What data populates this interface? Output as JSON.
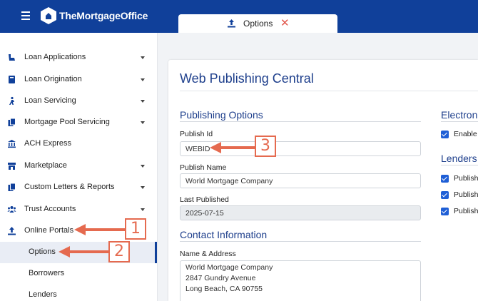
{
  "header": {
    "brand": "TheMortgageOffice",
    "tab": {
      "label": "Options",
      "close": "✕"
    }
  },
  "sidebar": {
    "items": [
      {
        "label": "Loan Applications",
        "icon": "loan-applications-icon"
      },
      {
        "label": "Loan Origination",
        "icon": "loan-origination-icon"
      },
      {
        "label": "Loan Servicing",
        "icon": "loan-servicing-icon"
      },
      {
        "label": "Mortgage Pool Servicing",
        "icon": "mortgage-pool-icon"
      },
      {
        "label": "ACH Express",
        "icon": "bank-icon"
      },
      {
        "label": "Marketplace",
        "icon": "marketplace-icon"
      },
      {
        "label": "Custom Letters & Reports",
        "icon": "letters-icon"
      },
      {
        "label": "Trust Accounts",
        "icon": "trust-accounts-icon"
      },
      {
        "label": "Online Portals",
        "icon": "upload-icon"
      }
    ],
    "subitems": [
      {
        "label": "Options"
      },
      {
        "label": "Borrowers"
      },
      {
        "label": "Lenders"
      }
    ]
  },
  "main": {
    "title": "Web Publishing Central",
    "publishing_options": {
      "heading": "Publishing Options",
      "publish_id_label": "Publish Id",
      "publish_id_value": "WEBID",
      "publish_name_label": "Publish Name",
      "publish_name_value": "World Mortgage Company",
      "last_published_label": "Last Published",
      "last_published_value": "2025-07-15"
    },
    "contact": {
      "heading": "Contact Information",
      "name_address_label": "Name & Address",
      "address_lines": [
        "World Mortgage Company",
        "2847 Gundry Avenue",
        "Long Beach, CA 90755"
      ]
    },
    "electronic": {
      "heading": "Electron",
      "checkbox_label": "Enable"
    },
    "lenders": {
      "heading": "Lenders",
      "checkbox_labels": [
        "Publish",
        "Publish",
        "Publish"
      ]
    }
  },
  "annotations": {
    "callout_1": "1",
    "callout_2": "2",
    "callout_3": "3"
  },
  "colors": {
    "header": "#10409a",
    "accent": "#1e3f8c",
    "annotation": "#e56a4f",
    "checkbox": "#1f5fd6"
  }
}
